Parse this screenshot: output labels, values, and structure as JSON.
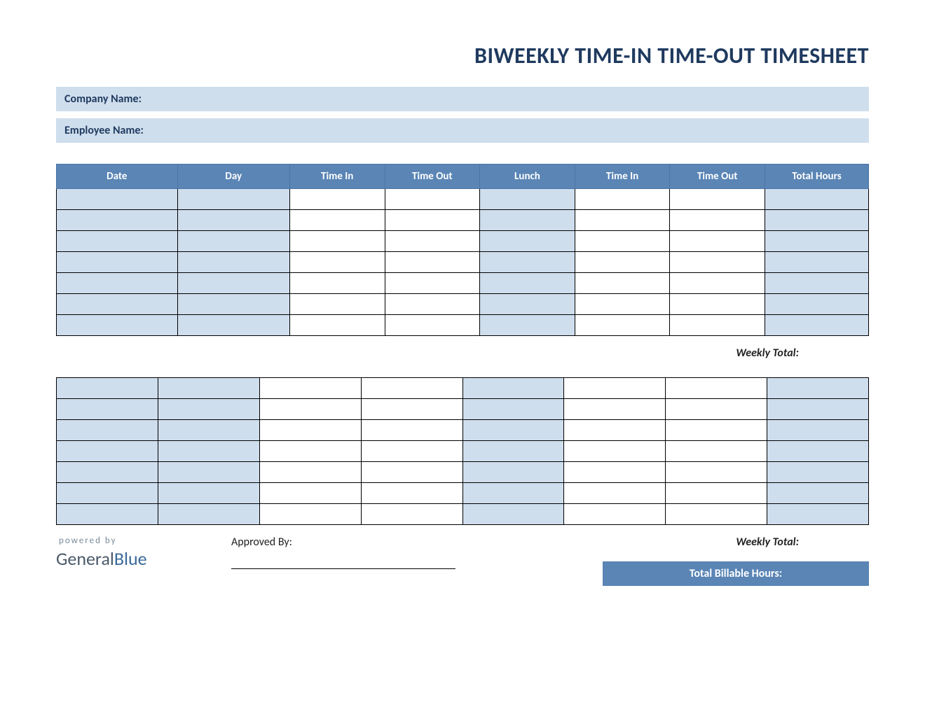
{
  "title": "BIWEEKLY TIME-IN TIME-OUT TIMESHEET",
  "company_label": "Company Name:",
  "employee_label": "Employee Name:",
  "columns": [
    "Date",
    "Day",
    "Time In",
    "Time Out",
    "Lunch",
    "Time In",
    "Time Out",
    "Total Hours"
  ],
  "week1_rows": [
    [
      "",
      "",
      "",
      "",
      "",
      "",
      "",
      ""
    ],
    [
      "",
      "",
      "",
      "",
      "",
      "",
      "",
      ""
    ],
    [
      "",
      "",
      "",
      "",
      "",
      "",
      "",
      ""
    ],
    [
      "",
      "",
      "",
      "",
      "",
      "",
      "",
      ""
    ],
    [
      "",
      "",
      "",
      "",
      "",
      "",
      "",
      ""
    ],
    [
      "",
      "",
      "",
      "",
      "",
      "",
      "",
      ""
    ],
    [
      "",
      "",
      "",
      "",
      "",
      "",
      "",
      ""
    ]
  ],
  "week2_rows": [
    [
      "",
      "",
      "",
      "",
      "",
      "",
      "",
      ""
    ],
    [
      "",
      "",
      "",
      "",
      "",
      "",
      "",
      ""
    ],
    [
      "",
      "",
      "",
      "",
      "",
      "",
      "",
      ""
    ],
    [
      "",
      "",
      "",
      "",
      "",
      "",
      "",
      ""
    ],
    [
      "",
      "",
      "",
      "",
      "",
      "",
      "",
      ""
    ],
    [
      "",
      "",
      "",
      "",
      "",
      "",
      "",
      ""
    ],
    [
      "",
      "",
      "",
      "",
      "",
      "",
      "",
      ""
    ]
  ],
  "weekly_total_label": "Weekly Total:",
  "approved_by_label": "Approved By:",
  "total_billable_label": "Total Billable Hours:",
  "powered_by": "powered by",
  "logo_general": "General",
  "logo_blue": "Blue",
  "shaded_cols": [
    0,
    1,
    4,
    7
  ]
}
